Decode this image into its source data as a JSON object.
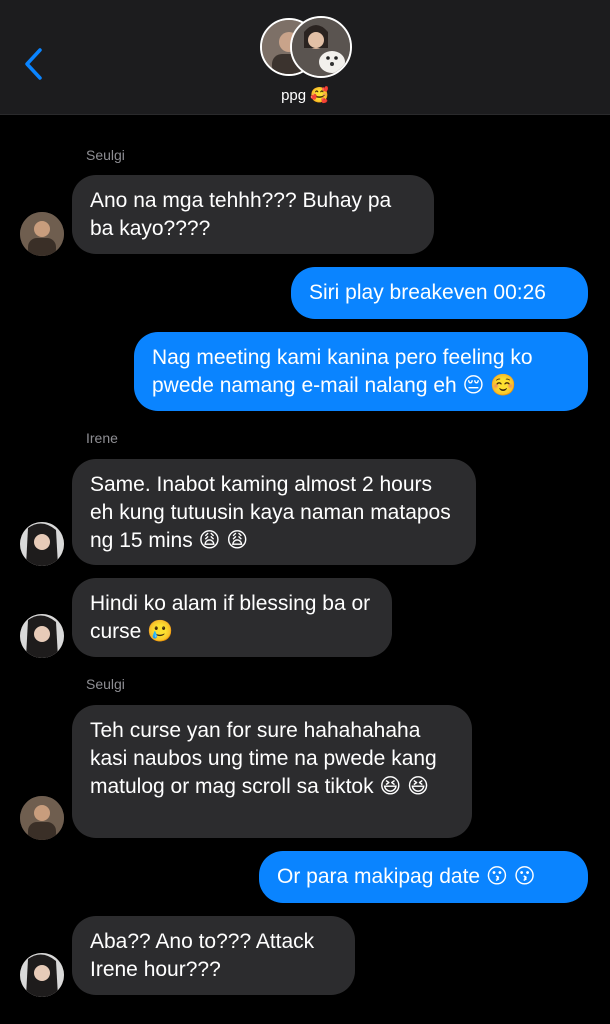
{
  "header": {
    "group_name": "ppg 🥰"
  },
  "messages": [
    {
      "sender": "Seulgi",
      "text": "Ano na mga tehhh??? Buhay pa ba kayo????"
    },
    {
      "text": "Siri play breakeven 00:26"
    },
    {
      "text": "Nag meeting kami kanina pero feeling ko pwede namang e-mail nalang eh 😔 ☺️"
    },
    {
      "sender": "Irene",
      "text": "Same. Inabot kaming almost 2 hours eh kung tutuusin kaya naman matapos ng 15 mins 😩 😩"
    },
    {
      "text": "Hindi ko alam if blessing ba or curse 🥲"
    },
    {
      "sender": "Seulgi",
      "text": "Teh curse yan for sure hahahahaha kasi naubos ung time na pwede kang matulog or mag scroll sa tiktok 😆 😆"
    },
    {
      "text": "Or para makipag date 😗 😗"
    },
    {
      "text": "Aba?? Ano to??? Attack Irene hour???"
    }
  ],
  "colors": {
    "outgoing": "#0a84ff",
    "incoming": "#2c2c2e",
    "background": "#000000",
    "header": "#1c1c1e"
  }
}
